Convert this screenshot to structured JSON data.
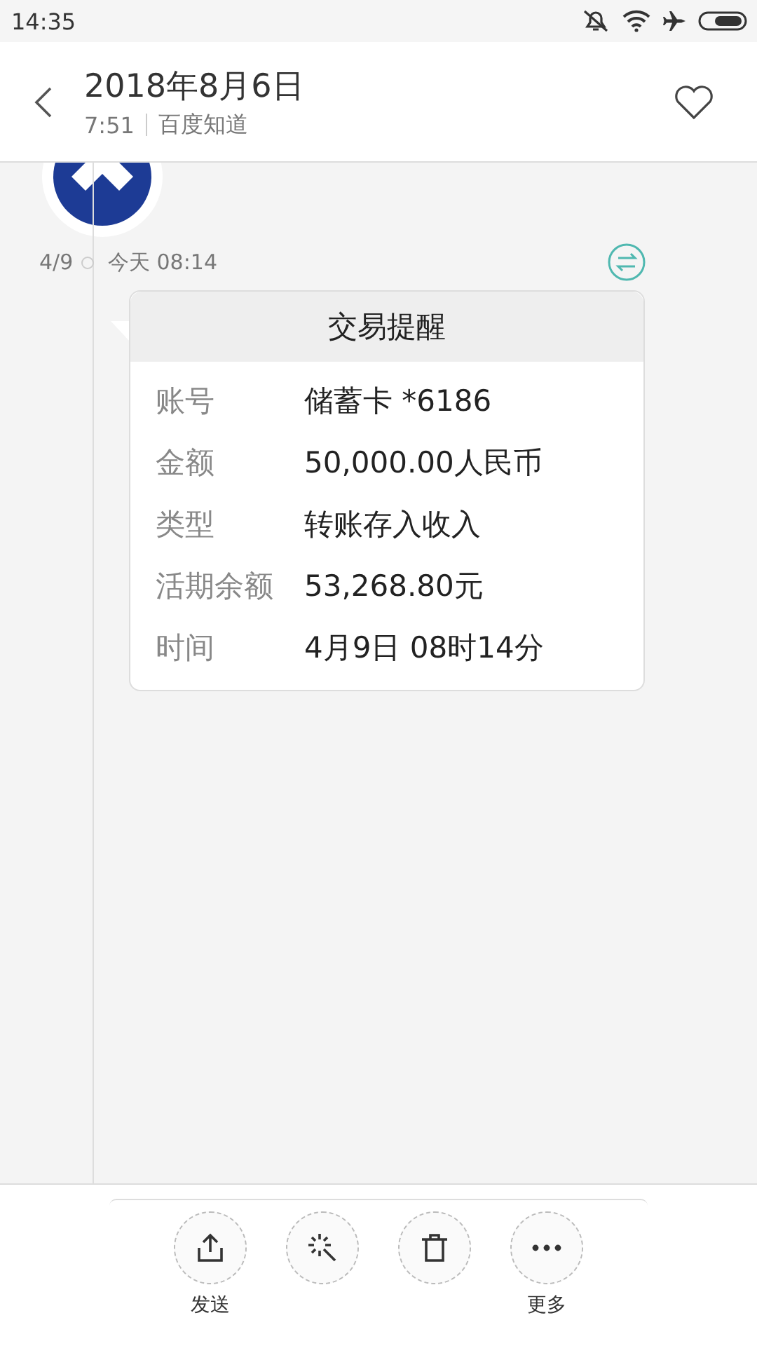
{
  "status_bar": {
    "time": "14:35"
  },
  "header": {
    "title": "2018年8月6日",
    "time": "7:51",
    "source": "百度知道",
    "favorite": false
  },
  "message": {
    "counter": "4/9",
    "timestamp": "今天 08:14",
    "card": {
      "title": "交易提醒",
      "rows": [
        {
          "label": "账号",
          "value": "储蓄卡 *6186"
        },
        {
          "label": "金额",
          "value": "50,000.00人民币"
        },
        {
          "label": "类型",
          "value": "转账存入收入"
        },
        {
          "label": "活期余额",
          "value": "53,268.80元"
        },
        {
          "label": "时间",
          "value": "4月9日 08时14分"
        }
      ]
    }
  },
  "toolbar": [
    {
      "kind": "share",
      "label": "发送"
    },
    {
      "kind": "effects"
    },
    {
      "kind": "delete"
    },
    {
      "kind": "more",
      "label": "更多"
    }
  ]
}
